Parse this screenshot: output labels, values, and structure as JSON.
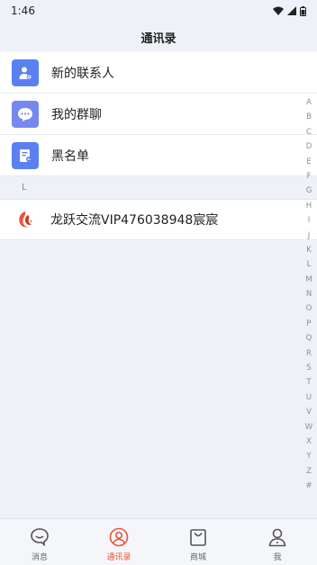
{
  "status_bar": {
    "time": "1:46",
    "icons": [
      "wifi-icon",
      "signal-icon",
      "battery-icon"
    ]
  },
  "header": {
    "title": "通讯录"
  },
  "menu_items": [
    {
      "label": "新的联系人",
      "icon": "new-contact-icon"
    },
    {
      "label": "我的群聊",
      "icon": "group-chat-icon"
    },
    {
      "label": "黑名单",
      "icon": "blacklist-icon"
    }
  ],
  "sections": [
    {
      "letter": "L",
      "contacts": [
        {
          "name": "龙跃交流VIP476038948宸宸",
          "avatar": "flame-logo"
        }
      ]
    }
  ],
  "index_letters": [
    "A",
    "B",
    "C",
    "D",
    "E",
    "F",
    "G",
    "H",
    "I",
    "J",
    "K",
    "L",
    "M",
    "N",
    "O",
    "P",
    "Q",
    "R",
    "S",
    "T",
    "U",
    "V",
    "W",
    "X",
    "Y",
    "Z",
    "#"
  ],
  "tabs": [
    {
      "label": "消息",
      "icon": "message-icon",
      "active": false
    },
    {
      "label": "通讯录",
      "icon": "contacts-icon",
      "active": true
    },
    {
      "label": "商城",
      "icon": "shopping-bag-icon",
      "active": false
    },
    {
      "label": "我",
      "icon": "profile-icon",
      "active": false
    }
  ],
  "colors": {
    "accent": "#5a80f2",
    "active_tab": "#e8543a",
    "background": "#eef2f8"
  }
}
